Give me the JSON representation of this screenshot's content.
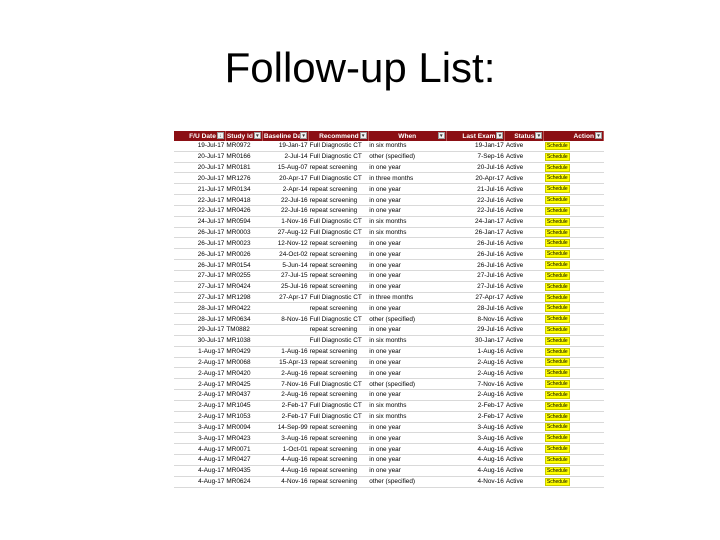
{
  "title": "Follow-up List:",
  "headers": [
    "F/U Date",
    "Study Id",
    "Baseline Date",
    "Recommend",
    "When",
    "Last Exam",
    "Status",
    "Action"
  ],
  "rows": [
    [
      "19-Jul-17",
      "MR0972",
      "19-Jan-17",
      "Full Diagnostic CT",
      "in six months",
      "19-Jan-17",
      "Active",
      "Schedule"
    ],
    [
      "20-Jul-17",
      "MR0166",
      "2-Jul-14",
      "Full Diagnostic CT",
      "other (specified)",
      "7-Sep-16",
      "Active",
      "Schedule"
    ],
    [
      "20-Jul-17",
      "MR0181",
      "15-Aug-07",
      "repeat screening",
      "in one year",
      "20-Jul-16",
      "Active",
      "Schedule"
    ],
    [
      "20-Jul-17",
      "MR1276",
      "20-Apr-17",
      "Full Diagnostic CT",
      "in three months",
      "20-Apr-17",
      "Active",
      "Schedule"
    ],
    [
      "21-Jul-17",
      "MR0134",
      "2-Apr-14",
      "repeat screening",
      "in one year",
      "21-Jul-16",
      "Active",
      "Schedule"
    ],
    [
      "22-Jul-17",
      "MR0418",
      "22-Jul-16",
      "repeat screening",
      "in one year",
      "22-Jul-16",
      "Active",
      "Schedule"
    ],
    [
      "22-Jul-17",
      "MR0426",
      "22-Jul-16",
      "repeat screening",
      "in one year",
      "22-Jul-16",
      "Active",
      "Schedule"
    ],
    [
      "24-Jul-17",
      "MR0594",
      "1-Nov-16",
      "Full Diagnostic CT",
      "in six months",
      "24-Jan-17",
      "Active",
      "Schedule"
    ],
    [
      "26-Jul-17",
      "MR0003",
      "27-Aug-12",
      "Full Diagnostic CT",
      "in six months",
      "26-Jan-17",
      "Active",
      "Schedule"
    ],
    [
      "26-Jul-17",
      "MR0023",
      "12-Nov-12",
      "repeat screening",
      "in one year",
      "26-Jul-16",
      "Active",
      "Schedule"
    ],
    [
      "26-Jul-17",
      "MR0026",
      "24-Oct-02",
      "repeat screening",
      "in one year",
      "26-Jul-16",
      "Active",
      "Schedule"
    ],
    [
      "26-Jul-17",
      "MR0154",
      "5-Jun-14",
      "repeat screening",
      "in one year",
      "26-Jul-16",
      "Active",
      "Schedule"
    ],
    [
      "27-Jul-17",
      "MR0255",
      "27-Jul-15",
      "repeat screening",
      "in one year",
      "27-Jul-16",
      "Active",
      "Schedule"
    ],
    [
      "27-Jul-17",
      "MR0424",
      "25-Jul-16",
      "repeat screening",
      "in one year",
      "27-Jul-16",
      "Active",
      "Schedule"
    ],
    [
      "27-Jul-17",
      "MR1298",
      "27-Apr-17",
      "Full Diagnostic CT",
      "in three months",
      "27-Apr-17",
      "Active",
      "Schedule"
    ],
    [
      "28-Jul-17",
      "MR0422",
      "",
      "repeat screening",
      "in one year",
      "28-Jul-16",
      "Active",
      "Schedule"
    ],
    [
      "28-Jul-17",
      "MR0634",
      "8-Nov-16",
      "Full Diagnostic CT",
      "other (specified)",
      "8-Nov-16",
      "Active",
      "Schedule"
    ],
    [
      "29-Jul-17",
      "TM0882",
      "",
      "repeat screening",
      "in one year",
      "29-Jul-16",
      "Active",
      "Schedule"
    ],
    [
      "30-Jul-17",
      "MR1038",
      "",
      "Full Diagnostic CT",
      "in six months",
      "30-Jan-17",
      "Active",
      "Schedule"
    ],
    [
      "1-Aug-17",
      "MR0429",
      "1-Aug-16",
      "repeat screening",
      "in one year",
      "1-Aug-16",
      "Active",
      "Schedule"
    ],
    [
      "2-Aug-17",
      "MR0068",
      "15-Apr-13",
      "repeat screening",
      "in one year",
      "2-Aug-16",
      "Active",
      "Schedule"
    ],
    [
      "2-Aug-17",
      "MR0420",
      "2-Aug-16",
      "repeat screening",
      "in one year",
      "2-Aug-16",
      "Active",
      "Schedule"
    ],
    [
      "2-Aug-17",
      "MR0425",
      "7-Nov-16",
      "Full Diagnostic CT",
      "other (specified)",
      "7-Nov-16",
      "Active",
      "Schedule"
    ],
    [
      "2-Aug-17",
      "MR0437",
      "2-Aug-16",
      "repeat screening",
      "in one year",
      "2-Aug-16",
      "Active",
      "Schedule"
    ],
    [
      "2-Aug-17",
      "MR1045",
      "2-Feb-17",
      "Full Diagnostic CT",
      "in six months",
      "2-Feb-17",
      "Active",
      "Schedule"
    ],
    [
      "2-Aug-17",
      "MR1053",
      "2-Feb-17",
      "Full Diagnostic CT",
      "in six months",
      "2-Feb-17",
      "Active",
      "Schedule"
    ],
    [
      "3-Aug-17",
      "MR0094",
      "14-Sep-99",
      "repeat screening",
      "in one year",
      "3-Aug-16",
      "Active",
      "Schedule"
    ],
    [
      "3-Aug-17",
      "MR0423",
      "3-Aug-16",
      "repeat screening",
      "in one year",
      "3-Aug-16",
      "Active",
      "Schedule"
    ],
    [
      "4-Aug-17",
      "MR0071",
      "1-Oct-01",
      "repeat screening",
      "in one year",
      "4-Aug-16",
      "Active",
      "Schedule"
    ],
    [
      "4-Aug-17",
      "MR0427",
      "4-Aug-16",
      "repeat screening",
      "in one year",
      "4-Aug-16",
      "Active",
      "Schedule"
    ],
    [
      "4-Aug-17",
      "MR0435",
      "4-Aug-16",
      "repeat screening",
      "in one year",
      "4-Aug-16",
      "Active",
      "Schedule"
    ],
    [
      "4-Aug-17",
      "MR0624",
      "4-Nov-16",
      "repeat screening",
      "other (specified)",
      "4-Nov-16",
      "Active",
      "Schedule"
    ]
  ],
  "colors": {
    "header_bg": "#8b0f14",
    "header_text": "#ffffff",
    "action_bg": "#ffff00"
  },
  "icons": {
    "filter": "dropdown-filter-icon",
    "sort": "sort-ascending-filter-icon"
  }
}
